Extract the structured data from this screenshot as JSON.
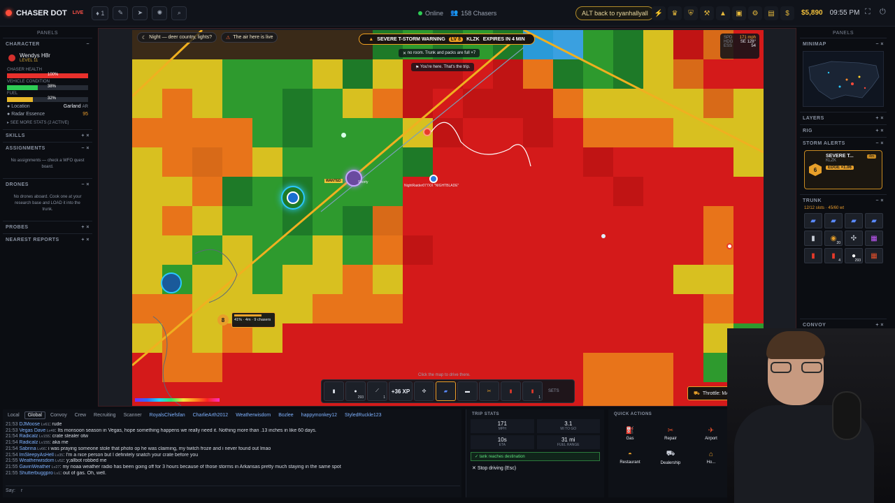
{
  "topbar": {
    "brand": "CHASER DOT",
    "live": "LIVE",
    "count_badge": "1",
    "online": "Online",
    "chasers": "158 Chasers",
    "alt_back": "ALT back to ryanhallyall",
    "money": "$5,890",
    "time": "09:55 PM"
  },
  "left": {
    "panels_title": "PANELS",
    "character_title": "CHARACTER",
    "char_name": "Wendys H8r",
    "char_level": "LEVEL 11",
    "health_label": "CHASER HEALTH",
    "health_pct": "100%",
    "health_value": 1.0,
    "vehicle_label": "VEHICLE CONDITION",
    "vehicle_pct": "38%",
    "vehicle_value": 0.38,
    "fuel_label": "FUEL",
    "fuel_pct": "32%",
    "fuel_value": 0.32,
    "location_label": "Location",
    "location_value": "Garland",
    "location_state": "AR",
    "radar_label": "Radar Essence",
    "radar_value": "95",
    "see_more": "SEE MORE STATS (2 ACTIVE)",
    "skills": "SKILLS",
    "assignments": "ASSIGNMENTS",
    "assignments_note": "No assignments — check a WFO quest board.",
    "drones": "DRONES",
    "drones_note": "No drones aboard. Cook one at your research base and LOAD it into the trunk.",
    "probes": "PROBES",
    "nearest": "NEAREST REPORTS"
  },
  "map": {
    "tag1": "Night — deer country, lights?",
    "tag2": "The air here is live",
    "warning_title": "SEVERE T-STORM WARNING",
    "warning_lvl": "LV 8",
    "warning_station": "KLZK",
    "warning_expires": "EXPIRES IN 4 MIN",
    "toast1": "no room. Trunk and packs are full",
    "toast1_count": "×7",
    "toast2": "You're here. That's the trip.",
    "spd_label": "SPD",
    "spd_value": "171 mph",
    "hdg_label": "HDG",
    "hdg_value": "SE 128°",
    "ess_label": "ESS",
    "ess_value": "54",
    "wanted": "WANTED",
    "player_label": "Shorty",
    "other_label": "NightRaider077XX \"NIGHTBLADE\"",
    "chaser_box_line1": "41% · 4m · 9 chasers",
    "chaser_badge": "8",
    "xp": "+36 XP",
    "click_hint": "Click the map to drive there.",
    "sets": "SETS",
    "throttle": "Throttle: MAX",
    "hotbar_counts": [
      "",
      "293",
      "1",
      "",
      "",
      "",
      "",
      "",
      "",
      "1"
    ]
  },
  "right": {
    "panels_title": "PANELS",
    "minimap": "MINIMAP",
    "layers": "LAYERS",
    "rig": "RIG",
    "storm_alerts": "STORM ALERTS",
    "alert_title": "SEVERE T...",
    "alert_time": "4m",
    "alert_station": "KLZK",
    "alert_badge": "6",
    "alert_edge": "EDGE ×1.06",
    "trunk": "TRUNK",
    "trunk_info": "12/12 slots · 45/60 wt",
    "trunk_counts": [
      "",
      "",
      "",
      "",
      "",
      "20",
      "",
      "",
      "",
      "4",
      "293",
      ""
    ],
    "convoy": "CONVOY"
  },
  "chat": {
    "tabs": [
      "Local",
      "Global",
      "Convoy",
      "Crew",
      "Recruiting",
      "Scanner"
    ],
    "users": [
      "RoyalsChiefsfan",
      "CharlieArth2012",
      "Weatherwisdom",
      "Bozlee",
      "happymonkey12",
      "StyledRuckle123"
    ],
    "lines": [
      {
        "t": "21:53",
        "u": "DJMoose",
        "lv": "Lv61",
        "m": ": rude"
      },
      {
        "t": "21:53",
        "u": "Vegas Dave",
        "lv": "Lv48",
        "m": ": Its monsoon season in Vegas, hope something happens we really need it. Nothing more than .13 inches in like 60 days."
      },
      {
        "t": "21:54",
        "u": "Radicalz",
        "lv": "Lv155",
        "m": ": crate stealer otw"
      },
      {
        "t": "21:54",
        "u": "Radicalz",
        "lv": "Lv155",
        "m": ": aka me"
      },
      {
        "t": "21:54",
        "u": "Sabrina",
        "lv": "Lv66",
        "m": ": i was praying someone stole that photo op he was claiming, my twitch froze and i never found out lmao"
      },
      {
        "t": "21:54",
        "u": "ImSleepyAsHell",
        "lv": "Lv35",
        "m": ": I'm a nice person but I definitely snatch your crate before you"
      },
      {
        "t": "21:55",
        "u": "Weatherwisdom",
        "lv": "Lv52",
        "m": ": y;allbot robbed me"
      },
      {
        "t": "21:55",
        "u": "GavinWeather",
        "lv": "Lv27",
        "m": ": my noaa weather radio has been going off for 3 hours because of those storms in Arkansas pretty much staying in the same spot"
      },
      {
        "t": "21:55",
        "u": "Shutterbuggpro",
        "lv": "Lv1",
        "m": ": out of gas. Oh, well."
      }
    ],
    "say_label": "Say:",
    "say_value": "r"
  },
  "trip": {
    "title": "TRIP STATS",
    "mph": "171",
    "mph_label": "MPH",
    "mi_to_go": "3.1",
    "mi_to_go_label": "MI TO GO",
    "eta": "10s",
    "eta_label": "ETA",
    "fuel_range": "31 mi",
    "fuel_range_label": "FUEL RANGE",
    "dest": "✓ tank reaches destination",
    "stop": "Stop driving (Esc)"
  },
  "quick": {
    "title": "QUICK ACTIONS",
    "actions": [
      "Gas",
      "Repair",
      "Airport",
      "Restaurant",
      "Dealership",
      "Ho..."
    ]
  },
  "colors": {
    "accent": "#e8a02a",
    "danger": "#ff4d3a",
    "health": "#e8302c",
    "vehicle": "#2ecc55",
    "fuel": "#e8b82a"
  },
  "tile_rows": [
    "bbbbbbbbgGgGgCcGgYroR",
    "YYYGGGYgYrrRrOgGgYoRR",
    "YOYGGgGYOrRrrrOYYYYoY",
    "OOOOGgGGGYrRRrROOOYYY",
    "YOoOYGGGGgRRRRRrRRRRY",
    "YYOgGgGGGRRRRRRRrRRRR",
    "YOYGGgGgoRRRRRRRRRROR",
    "YYGYGGYGOrRRRRRRRRROR",
    "YGYYGYYOYRRRRRRRRRYYR",
    "OOYYYYOOORRRRRRRRRROR",
    "YOYOYRRRRRRRRRRRRRRYG",
    "ROORRRRRRRRRRRROOORGG",
    "RRRRRRRRRRRRRRROOORRR"
  ]
}
